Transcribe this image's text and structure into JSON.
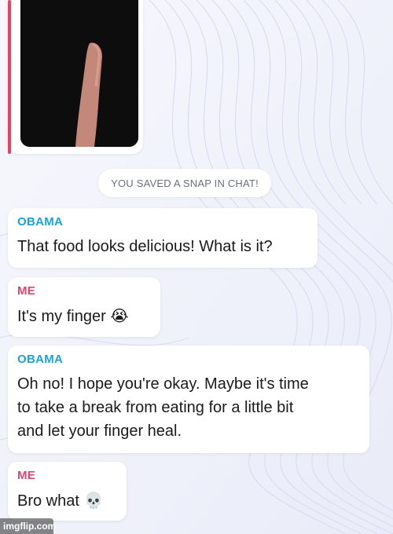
{
  "colors": {
    "obama_name": "#1aa3d9",
    "me_name": "#e0466a",
    "accent_bar": "#e5435f"
  },
  "snap": {
    "image_icon": "finger-photo"
  },
  "system_notice": "YOU SAVED A SNAP IN CHAT!",
  "messages": [
    {
      "sender": "OBAMA",
      "text": "That food looks delicious! What is it?",
      "emoji": ""
    },
    {
      "sender": "ME",
      "text": "It's my finger",
      "emoji": "😭"
    },
    {
      "sender": "OBAMA",
      "lines": [
        "Oh no! I hope you're okay. Maybe it's time",
        "to take a break from eating for a little bit",
        "and let your finger heal."
      ],
      "emoji": ""
    },
    {
      "sender": "ME",
      "text": "Bro what",
      "emoji": "💀"
    }
  ],
  "watermark": "imgflip.com"
}
